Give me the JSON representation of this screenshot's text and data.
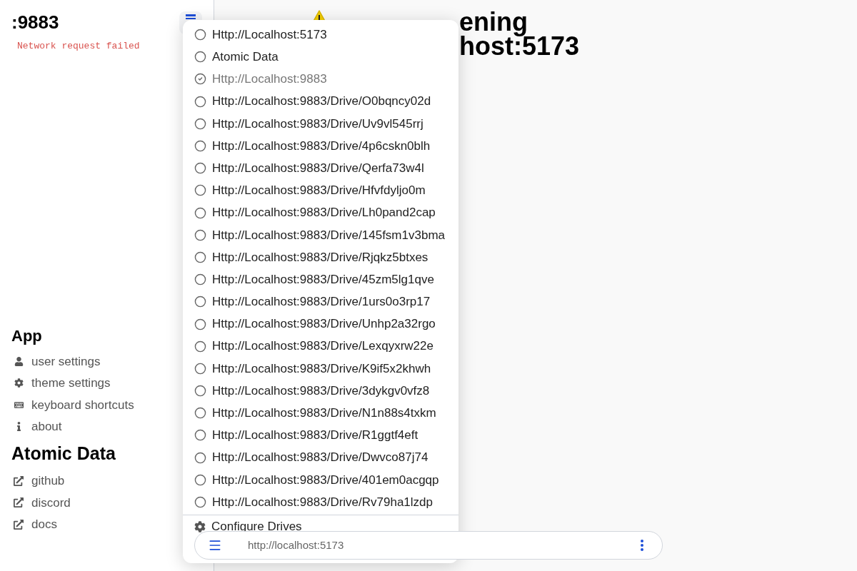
{
  "sidebar": {
    "drive_title": ":9883",
    "error": "Network request failed",
    "app_heading": "App",
    "app_items": [
      {
        "kind": "user",
        "label": "user settings"
      },
      {
        "kind": "theme",
        "label": "theme settings"
      },
      {
        "kind": "keyboard",
        "label": "keyboard shortcuts"
      },
      {
        "kind": "about",
        "label": "about"
      }
    ],
    "brand_heading": "Atomic Data",
    "links": [
      {
        "label": "github"
      },
      {
        "label": "discord"
      },
      {
        "label": "docs"
      }
    ]
  },
  "main": {
    "heading_line_1": "ening",
    "heading_line_2": "host:5173"
  },
  "drive_menu": {
    "items": [
      {
        "label": "Http://Localhost:5173",
        "selected": false
      },
      {
        "label": "Atomic Data",
        "selected": false
      },
      {
        "label": "Http://Localhost:9883",
        "selected": true
      },
      {
        "label": "Http://Localhost:9883/Drive/O0bqncy02d",
        "selected": false
      },
      {
        "label": "Http://Localhost:9883/Drive/Uv9vl545rrj",
        "selected": false
      },
      {
        "label": "Http://Localhost:9883/Drive/4p6cskn0blh",
        "selected": false
      },
      {
        "label": "Http://Localhost:9883/Drive/Qerfa73w4l",
        "selected": false
      },
      {
        "label": "Http://Localhost:9883/Drive/Hfvfdyljo0m",
        "selected": false
      },
      {
        "label": "Http://Localhost:9883/Drive/Lh0pand2cap",
        "selected": false
      },
      {
        "label": "Http://Localhost:9883/Drive/145fsm1v3bma",
        "selected": false
      },
      {
        "label": "Http://Localhost:9883/Drive/Rjqkz5btxes",
        "selected": false
      },
      {
        "label": "Http://Localhost:9883/Drive/45zm5lg1qve",
        "selected": false
      },
      {
        "label": "Http://Localhost:9883/Drive/1urs0o3rp17",
        "selected": false
      },
      {
        "label": "Http://Localhost:9883/Drive/Unhp2a32rgo",
        "selected": false
      },
      {
        "label": "Http://Localhost:9883/Drive/Lexqyxrw22e",
        "selected": false
      },
      {
        "label": "Http://Localhost:9883/Drive/K9if5x2khwh",
        "selected": false
      },
      {
        "label": "Http://Localhost:9883/Drive/3dykgv0vfz8",
        "selected": false
      },
      {
        "label": "Http://Localhost:9883/Drive/N1n88s4txkm",
        "selected": false
      },
      {
        "label": "Http://Localhost:9883/Drive/R1ggtf4eft",
        "selected": false
      },
      {
        "label": "Http://Localhost:9883/Drive/Dwvco87j74",
        "selected": false
      },
      {
        "label": "Http://Localhost:9883/Drive/401em0acgqp",
        "selected": false
      },
      {
        "label": "Http://Localhost:9883/Drive/Rv79ha1lzdp",
        "selected": false
      }
    ],
    "configure": "Configure Drives"
  },
  "address_bar": {
    "value": "http://localhost:5173"
  }
}
